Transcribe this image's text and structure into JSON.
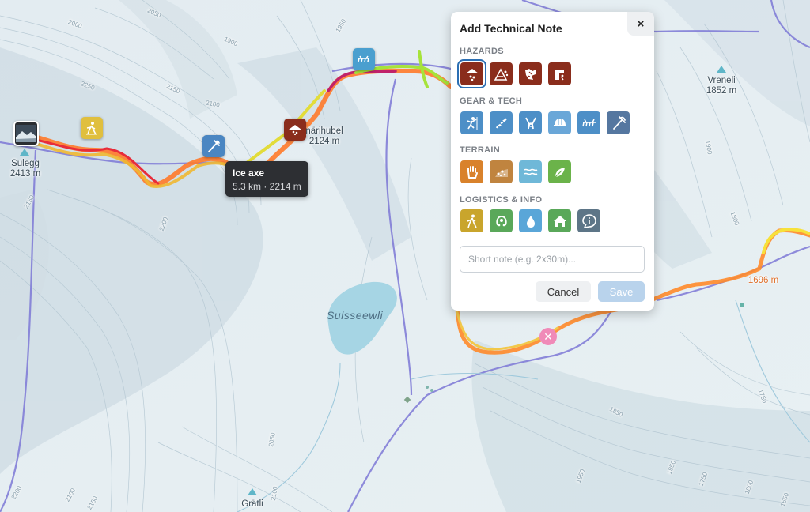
{
  "map": {
    "peaks": [
      {
        "name": "Sulegg",
        "elev": "2413 m"
      },
      {
        "name": "Vreneli",
        "elev": "1852 m"
      },
      {
        "name": "närihubel",
        "elev": "2124 m"
      },
      {
        "name": "Grätli",
        "elev": ""
      }
    ],
    "waypoint_elev": "1696 m",
    "lake_name": "Sulsseewli",
    "contour_labels": [
      "2000",
      "2250",
      "1900",
      "2150",
      "2050",
      "2100",
      "1950",
      "2200",
      "2150",
      "2100",
      "2050",
      "2200",
      "2150",
      "2100",
      "1850",
      "1800",
      "1900",
      "1850",
      "1750",
      "1950",
      "1800",
      "1650",
      "1750"
    ],
    "map_icons": [
      {
        "name": "photo-marker",
        "icon": "photo-icon"
      },
      {
        "name": "hiker-marker",
        "icon": "hiker-icon"
      },
      {
        "name": "ice-axe-marker",
        "icon": "ice-axe-icon"
      },
      {
        "name": "avalanche-marker",
        "icon": "avalanche-icon"
      },
      {
        "name": "crampons-marker",
        "icon": "crampons-icon"
      }
    ]
  },
  "tooltip": {
    "title": "Ice axe",
    "detail": "5.3 km · 2214 m"
  },
  "panel": {
    "title": "Add Technical Note",
    "close_label": "×",
    "sections": [
      {
        "label": "HAZARDS",
        "icons": [
          {
            "name": "avalanche-icon",
            "color": "#8a2d1c",
            "selected": true
          },
          {
            "name": "rockfall-icon",
            "color": "#8a2d1c"
          },
          {
            "name": "icefall-icon",
            "color": "#8a2d1c"
          },
          {
            "name": "steep-terrain-icon",
            "color": "#8a2d1c"
          }
        ]
      },
      {
        "label": "GEAR & TECH",
        "icons": [
          {
            "name": "climber-icon",
            "color": "#4d8fc7"
          },
          {
            "name": "rope-icon",
            "color": "#4d8fc7"
          },
          {
            "name": "harness-icon",
            "color": "#4d8fc7"
          },
          {
            "name": "helmet-icon",
            "color": "#4d8fc7"
          },
          {
            "name": "crampons-icon",
            "color": "#4d8fc7"
          },
          {
            "name": "ice-axe-icon",
            "color": "#4d8fc7"
          }
        ]
      },
      {
        "label": "TERRAIN",
        "icons": [
          {
            "name": "scramble-icon",
            "color": "#d9822b"
          },
          {
            "name": "scree-icon",
            "color": "#c0843f"
          },
          {
            "name": "water-crossing-icon",
            "color": "#6fb8d8"
          },
          {
            "name": "vegetation-icon",
            "color": "#6bb34a"
          }
        ]
      },
      {
        "label": "LOGISTICS & INFO",
        "icons": [
          {
            "name": "hiker-icon",
            "color": "#c9a52c"
          },
          {
            "name": "viewpoint-icon",
            "color": "#5aa85a"
          },
          {
            "name": "water-source-icon",
            "color": "#5aa6d8"
          },
          {
            "name": "hut-icon",
            "color": "#5aa85a"
          },
          {
            "name": "info-icon",
            "color": "#5d7587"
          }
        ]
      }
    ],
    "note_placeholder": "Short note (e.g. 2x30m)...",
    "cancel_label": "Cancel",
    "save_label": "Save"
  }
}
